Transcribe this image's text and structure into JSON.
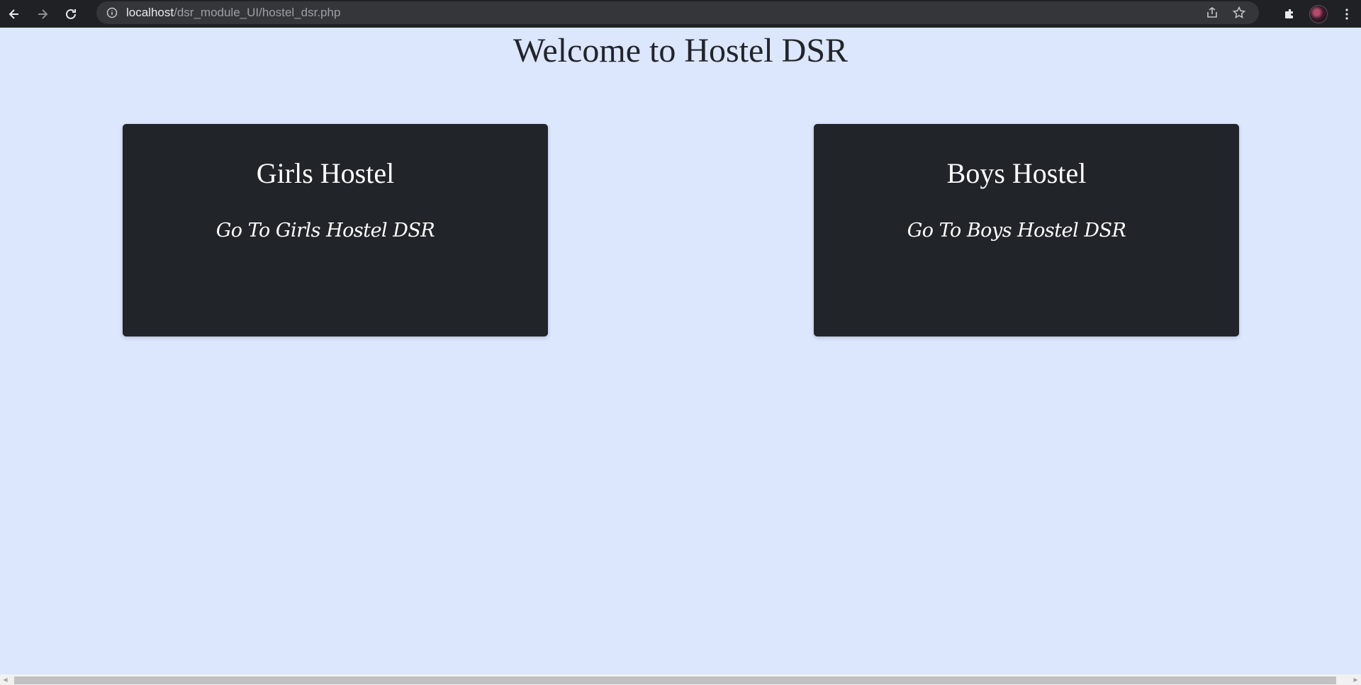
{
  "browser": {
    "url_host": "localhost",
    "url_path": "/dsr_module_UI/hostel_dsr.php",
    "icons": [
      "back-icon",
      "forward-icon",
      "reload-icon",
      "info-icon",
      "share-icon",
      "star-icon",
      "extensions-icon",
      "avatar",
      "menu-icon"
    ]
  },
  "page": {
    "title": "Welcome to Hostel DSR"
  },
  "cards": [
    {
      "title": "Girls Hostel",
      "link": "Go To Girls Hostel DSR"
    },
    {
      "title": "Boys Hostel",
      "link": "Go To Boys Hostel DSR"
    }
  ],
  "colors": {
    "background": "#dce6fd",
    "card": "#212529",
    "text_on_card": "#ffffff",
    "title_text": "#212529"
  }
}
